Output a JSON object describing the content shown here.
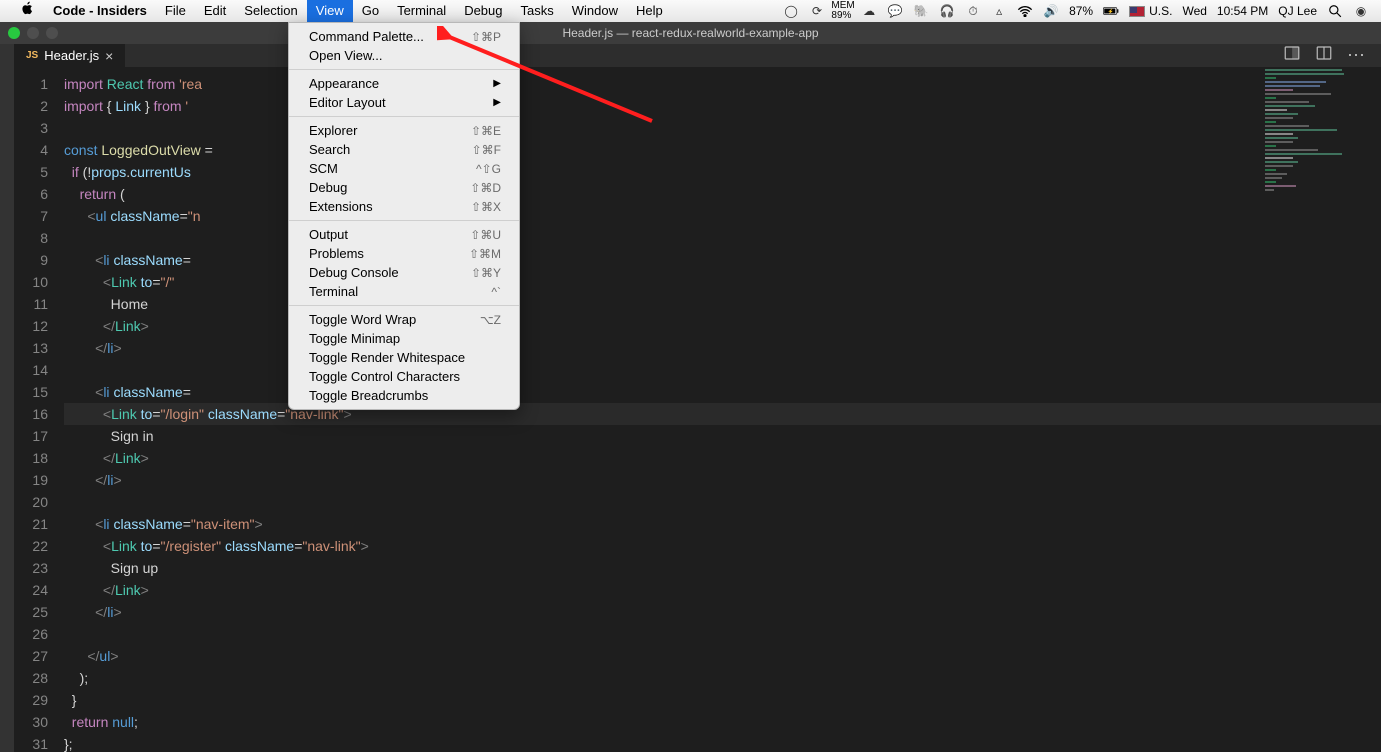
{
  "menubar": {
    "app": "Code - Insiders",
    "items": [
      "File",
      "Edit",
      "Selection",
      "View",
      "Go",
      "Terminal",
      "Debug",
      "Tasks",
      "Window",
      "Help"
    ],
    "active_index": 3,
    "status": {
      "mem": "MEM 89%",
      "battery": "87%",
      "input": "U.S.",
      "day": "Wed",
      "time": "10:54 PM",
      "user": "QJ Lee"
    }
  },
  "titlebar": {
    "title": "Header.js — react-redux-realworld-example-app"
  },
  "tab": {
    "icon": "JS",
    "name": "Header.js",
    "close": "×"
  },
  "dropdown": {
    "groups": [
      [
        {
          "label": "Command Palette...",
          "shortcut": "⇧⌘P"
        },
        {
          "label": "Open View...",
          "shortcut": ""
        }
      ],
      [
        {
          "label": "Appearance",
          "submenu": true
        },
        {
          "label": "Editor Layout",
          "submenu": true
        }
      ],
      [
        {
          "label": "Explorer",
          "shortcut": "⇧⌘E"
        },
        {
          "label": "Search",
          "shortcut": "⇧⌘F"
        },
        {
          "label": "SCM",
          "shortcut": "^⇧G"
        },
        {
          "label": "Debug",
          "shortcut": "⇧⌘D"
        },
        {
          "label": "Extensions",
          "shortcut": "⇧⌘X"
        }
      ],
      [
        {
          "label": "Output",
          "shortcut": "⇧⌘U"
        },
        {
          "label": "Problems",
          "shortcut": "⇧⌘M"
        },
        {
          "label": "Debug Console",
          "shortcut": "⇧⌘Y"
        },
        {
          "label": "Terminal",
          "shortcut": "^`"
        }
      ],
      [
        {
          "label": "Toggle Word Wrap",
          "shortcut": "⌥Z"
        },
        {
          "label": "Toggle Minimap",
          "shortcut": ""
        },
        {
          "label": "Toggle Render Whitespace",
          "shortcut": ""
        },
        {
          "label": "Toggle Control Characters",
          "shortcut": ""
        },
        {
          "label": "Toggle Breadcrumbs",
          "shortcut": ""
        }
      ]
    ]
  },
  "editor": {
    "lines": [
      {
        "n": 1,
        "html": "<span class='k'>import</span> <span class='cl'>React</span> <span class='k'>from</span> <span class='s'>'rea</span>"
      },
      {
        "n": 2,
        "html": "<span class='k'>import</span> <span class='p'>{</span> <span class='v'>Link</span> <span class='p'>}</span> <span class='k'>from</span> <span class='s'>'</span>"
      },
      {
        "n": 3,
        "html": ""
      },
      {
        "n": 4,
        "html": "<span class='tn'>const</span> <span class='fn'>LoggedOutView</span> <span class='p'>=</span> "
      },
      {
        "n": 5,
        "html": "  <span class='k'>if</span> <span class='p'>(</span><span class='p'>!</span><span class='v'>props</span><span class='p'>.</span><span class='v'>currentUs</span>"
      },
      {
        "n": 6,
        "html": "    <span class='k'>return</span> <span class='p'>(</span>"
      },
      {
        "n": 7,
        "html": "      <span class='t'>&lt;</span><span class='tn'>ul</span> <span class='at'>className</span><span class='p'>=</span><span class='s'>\"n</span>                                        <span class='s'>t\"</span><span class='t'>&gt;</span>"
      },
      {
        "n": 8,
        "html": ""
      },
      {
        "n": 9,
        "html": "        <span class='t'>&lt;</span><span class='tn'>li</span> <span class='at'>className</span><span class='p'>=</span>"
      },
      {
        "n": 10,
        "html": "          <span class='t'>&lt;</span><span class='cl'>Link</span> <span class='at'>to</span><span class='p'>=</span><span class='s'>\"/\"</span>"
      },
      {
        "n": 11,
        "html": "            Home"
      },
      {
        "n": 12,
        "html": "          <span class='t'>&lt;/</span><span class='cl'>Link</span><span class='t'>&gt;</span>"
      },
      {
        "n": 13,
        "html": "        <span class='t'>&lt;/</span><span class='tn'>li</span><span class='t'>&gt;</span>"
      },
      {
        "n": 14,
        "html": ""
      },
      {
        "n": 15,
        "html": "        <span class='t'>&lt;</span><span class='tn'>li</span> <span class='at'>className</span><span class='p'>=</span>"
      },
      {
        "n": 16,
        "hl": true,
        "html": "          <span class='t'>&lt;</span><span class='cl'>Link</span> <span class='at'>to</span><span class='p'>=</span><span class='s'>\"/login\"</span> <span class='at'>className</span><span class='p'>=</span><span class='s'>\"nav-link\"</span><span class='t'>&gt;</span>"
      },
      {
        "n": 17,
        "html": "            Sign in"
      },
      {
        "n": 18,
        "html": "          <span class='t'>&lt;/</span><span class='cl'>Link</span><span class='t'>&gt;</span>"
      },
      {
        "n": 19,
        "html": "        <span class='t'>&lt;/</span><span class='tn'>li</span><span class='t'>&gt;</span>"
      },
      {
        "n": 20,
        "html": ""
      },
      {
        "n": 21,
        "html": "        <span class='t'>&lt;</span><span class='tn'>li</span> <span class='at'>className</span><span class='p'>=</span><span class='s'>\"nav-item\"</span><span class='t'>&gt;</span>"
      },
      {
        "n": 22,
        "html": "          <span class='t'>&lt;</span><span class='cl'>Link</span> <span class='at'>to</span><span class='p'>=</span><span class='s'>\"/register\"</span> <span class='at'>className</span><span class='p'>=</span><span class='s'>\"nav-link\"</span><span class='t'>&gt;</span>"
      },
      {
        "n": 23,
        "html": "            Sign up"
      },
      {
        "n": 24,
        "html": "          <span class='t'>&lt;/</span><span class='cl'>Link</span><span class='t'>&gt;</span>"
      },
      {
        "n": 25,
        "html": "        <span class='t'>&lt;/</span><span class='tn'>li</span><span class='t'>&gt;</span>"
      },
      {
        "n": 26,
        "html": ""
      },
      {
        "n": 27,
        "html": "      <span class='t'>&lt;/</span><span class='tn'>ul</span><span class='t'>&gt;</span>"
      },
      {
        "n": 28,
        "html": "    <span class='p'>);</span>"
      },
      {
        "n": 29,
        "html": "  <span class='p'>}</span>"
      },
      {
        "n": 30,
        "html": "  <span class='k'>return</span> <span class='tn'>null</span><span class='p'>;</span>"
      },
      {
        "n": 31,
        "html": "<span class='p'>};</span>"
      }
    ]
  }
}
